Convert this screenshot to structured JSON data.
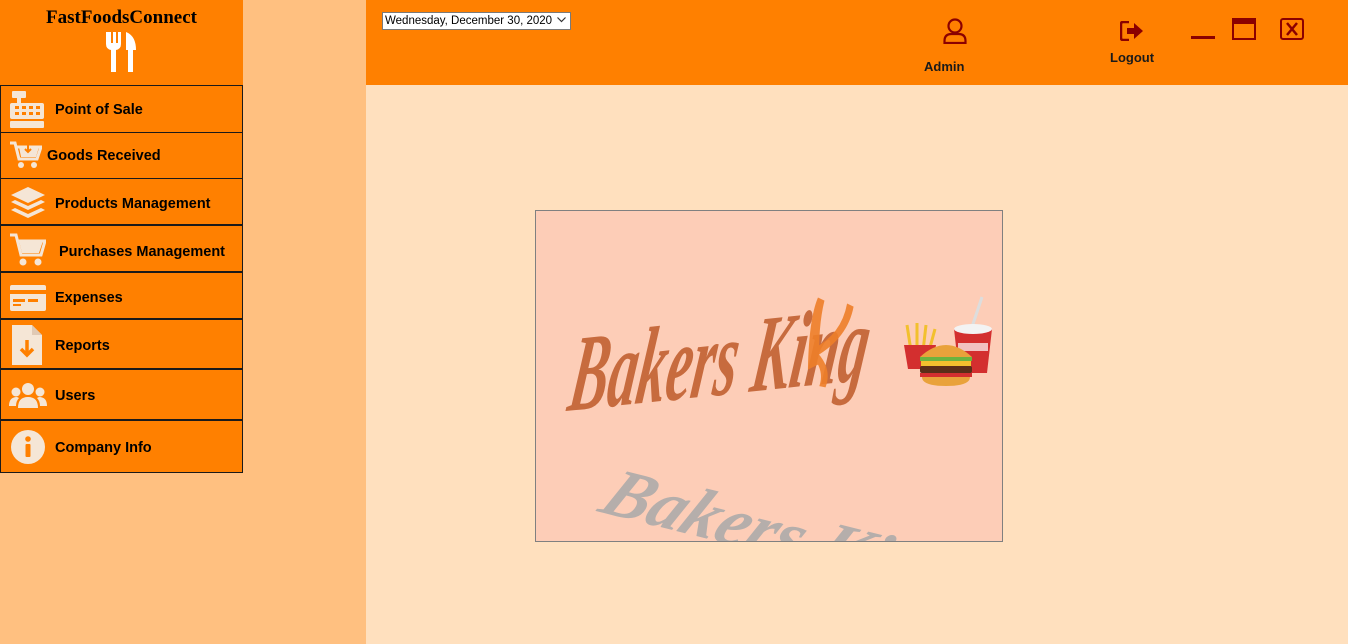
{
  "app": {
    "title": "FastFoodsConnect"
  },
  "sidebar": {
    "items": [
      {
        "label": "Point of Sale",
        "icon": "cash-register-icon"
      },
      {
        "label": "Goods Received",
        "icon": "cart-download-icon"
      },
      {
        "label": "Products Management",
        "icon": "layers-icon"
      },
      {
        "label": "Purchases Management",
        "icon": "shopping-cart-icon"
      },
      {
        "label": "Expenses",
        "icon": "credit-card-icon"
      },
      {
        "label": "Reports",
        "icon": "file-download-icon"
      },
      {
        "label": "Users",
        "icon": "users-icon"
      },
      {
        "label": "Company Info",
        "icon": "info-circle-icon"
      }
    ]
  },
  "topbar": {
    "date_value": "Wednesday, December 30, 2020",
    "user_label": "Admin",
    "logout_label": "Logout"
  },
  "logo": {
    "main_text": "Bakers King",
    "reflection_text": "Bakers King"
  },
  "colors": {
    "accent": "#FF8000",
    "sidebar_bg": "#FFC080",
    "content_bg": "#FFE0BE",
    "icon_dark_red": "#8B0000",
    "logo_bg": "#FDCDB7"
  }
}
